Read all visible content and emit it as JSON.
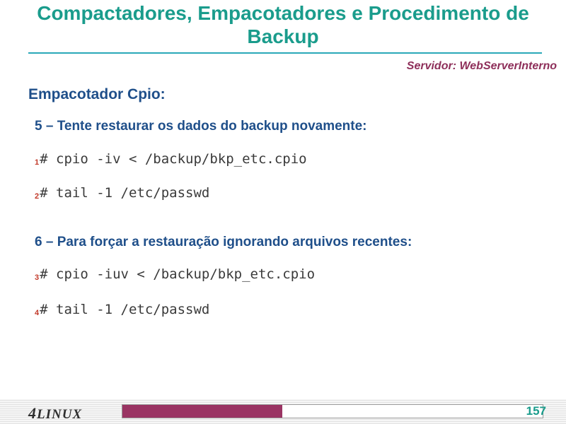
{
  "slide": {
    "title": "Compactadores, Empacotadores e Procedimento de Backup",
    "server_label": "Servidor: WebServerInterno",
    "section_heading": "Empacotador Cpio:",
    "steps": [
      {
        "text": "5 – Tente restaurar os dados do backup novamente:"
      },
      {
        "text": "6 – Para forçar a restauração ignorando arquivos recentes:"
      }
    ],
    "commands": [
      {
        "num": "1",
        "text": "# cpio -iv < /backup/bkp_etc.cpio"
      },
      {
        "num": "2",
        "text": "# tail -1 /etc/passwd"
      },
      {
        "num": "3",
        "text": "# cpio -iuv < /backup/bkp_etc.cpio"
      },
      {
        "num": "4",
        "text": "# tail -1 /etc/passwd"
      }
    ]
  },
  "footer": {
    "logo_digit": "4",
    "logo_text": "LINUX",
    "page_number": "157",
    "progress_fraction": 0.38,
    "accent_color": "#9a3463"
  }
}
